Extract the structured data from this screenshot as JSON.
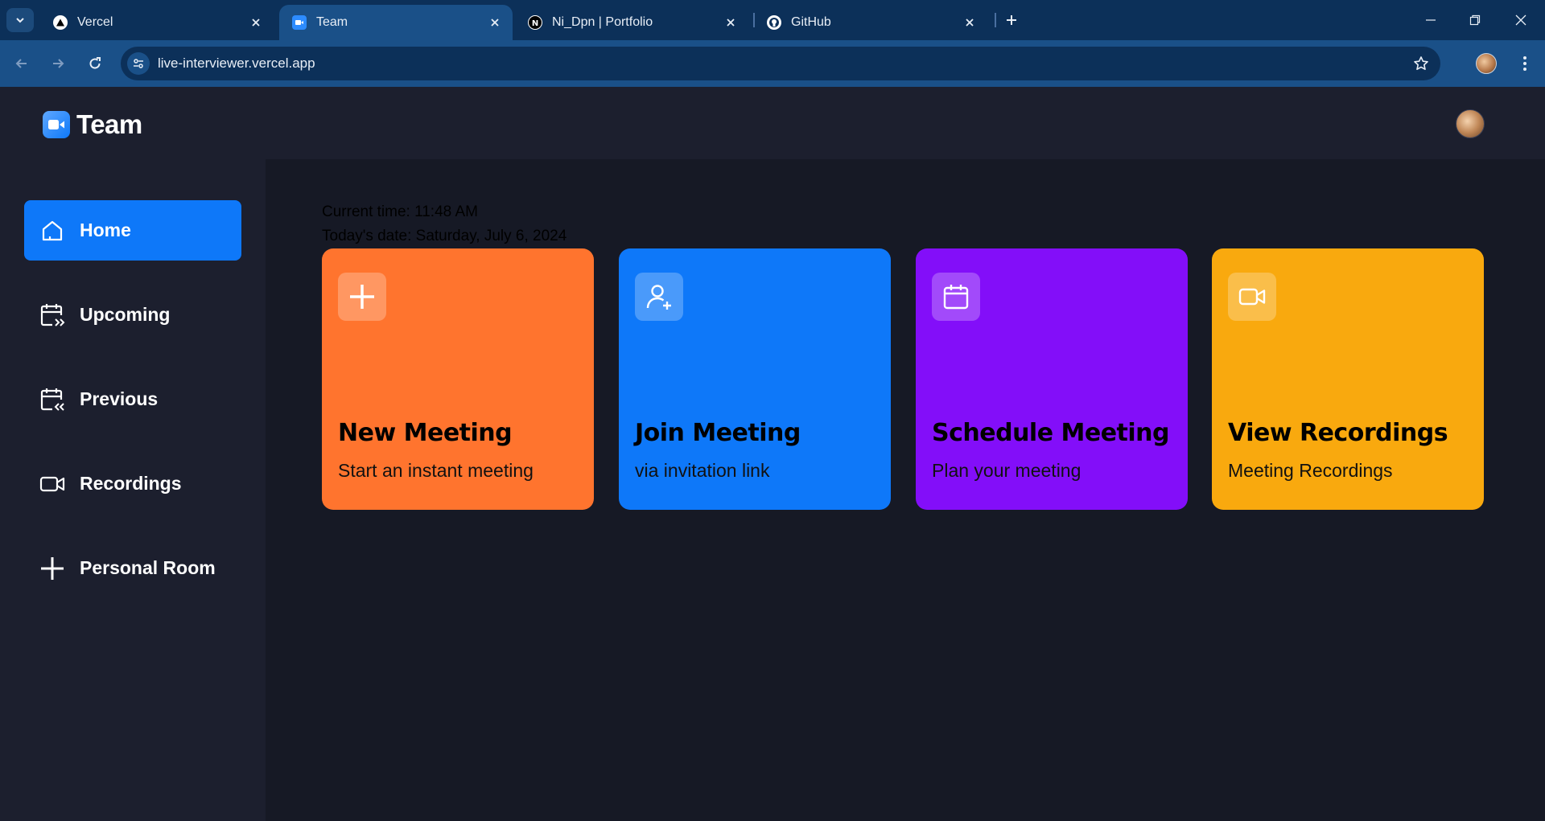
{
  "browser": {
    "tabs": [
      {
        "title": "Vercel",
        "favicon": "vercel-triangle",
        "active": false
      },
      {
        "title": "Team",
        "favicon": "video-camera",
        "active": true
      },
      {
        "title": "Ni_Dpn | Portfolio",
        "favicon": "n-logo",
        "active": false
      },
      {
        "title": "GitHub",
        "favicon": "github-octocat",
        "active": false
      }
    ],
    "url": "live-interviewer.vercel.app"
  },
  "app": {
    "name": "Team",
    "accent_color": "#0e78f9"
  },
  "sidebar": {
    "items": [
      {
        "label": "Home",
        "icon": "home-icon",
        "active": true
      },
      {
        "label": "Upcoming",
        "icon": "calendar-forward-icon",
        "active": false
      },
      {
        "label": "Previous",
        "icon": "calendar-back-icon",
        "active": false
      },
      {
        "label": "Recordings",
        "icon": "video-icon",
        "active": false
      },
      {
        "label": "Personal Room",
        "icon": "plus-icon",
        "active": false
      }
    ]
  },
  "main": {
    "current_time": "Current time: 11:48 AM",
    "todays_date": "Today's date: Saturday, July 6, 2024",
    "cards": [
      {
        "title": "New Meeting",
        "subtitle": "Start an instant meeting",
        "icon": "plus-icon",
        "color": "#ff742e"
      },
      {
        "title": "Join Meeting",
        "subtitle": "via invitation link",
        "icon": "user-plus-icon",
        "color": "#0e78f9"
      },
      {
        "title": "Schedule Meeting",
        "subtitle": "Plan your meeting",
        "icon": "calendar-icon",
        "color": "#830ef9"
      },
      {
        "title": "View Recordings",
        "subtitle": "Meeting Recordings",
        "icon": "video-icon",
        "color": "#f9a90e"
      }
    ]
  }
}
